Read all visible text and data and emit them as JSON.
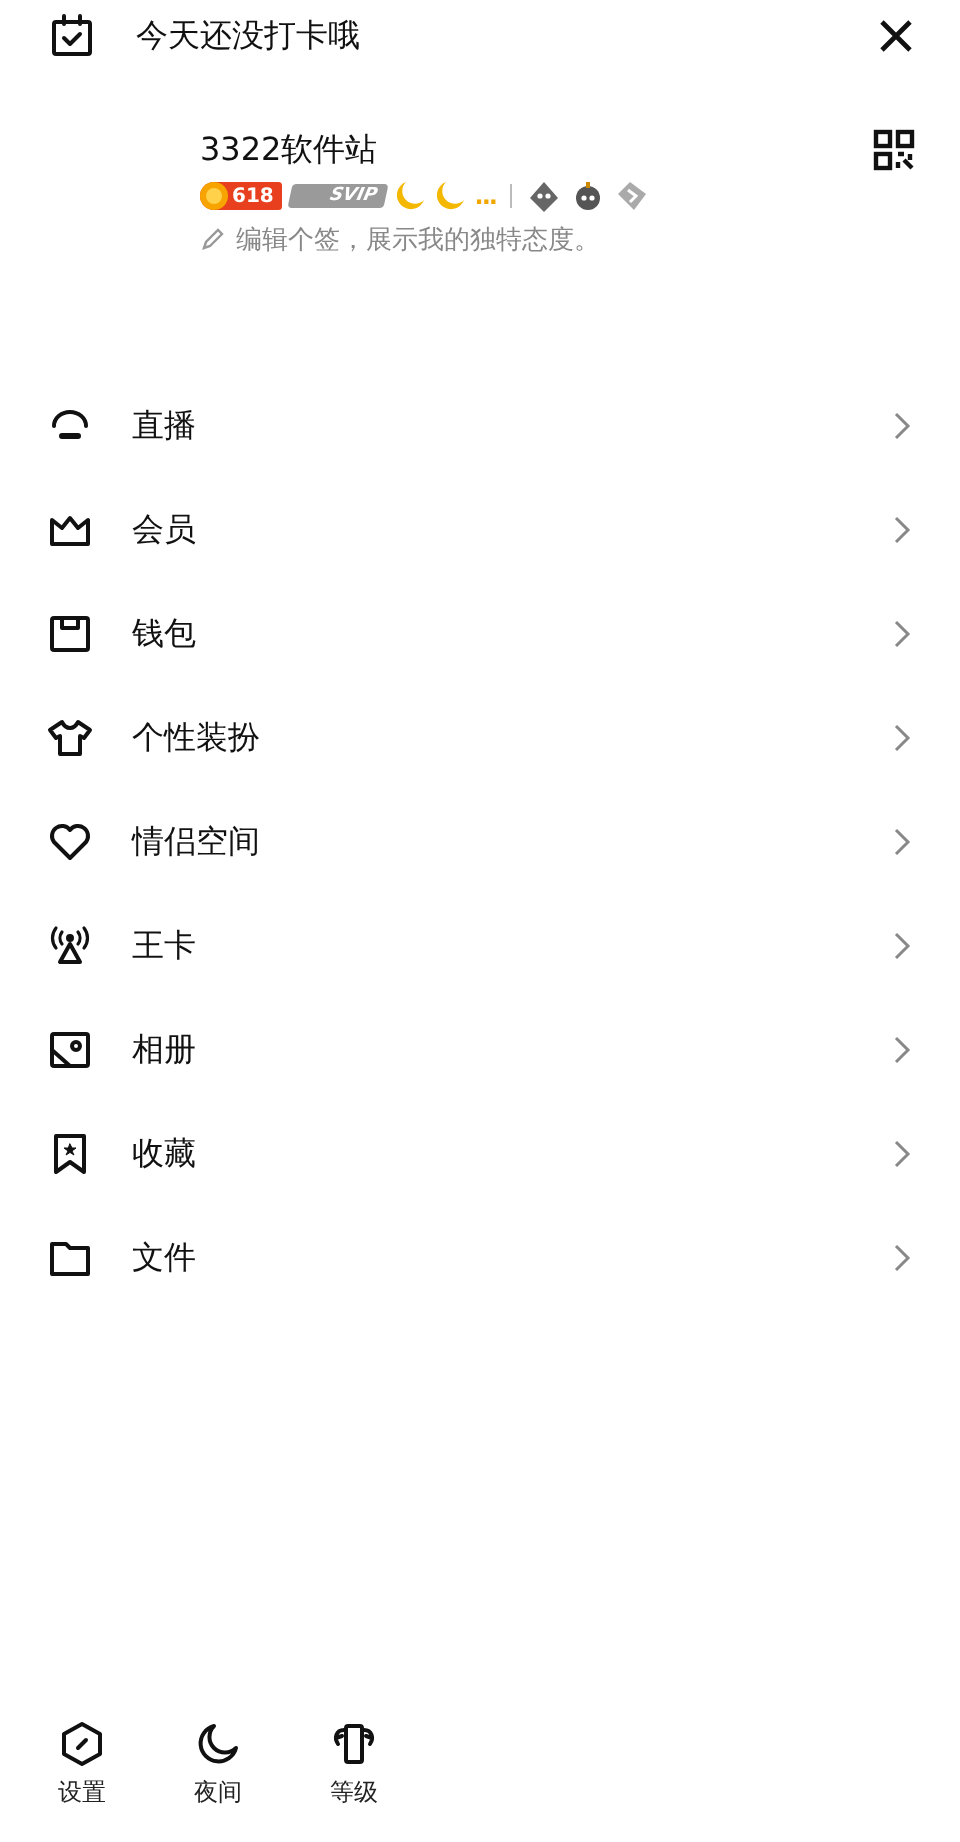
{
  "checkin": {
    "text": "今天还没打卡哦"
  },
  "profile": {
    "name": "3322软件站",
    "badges": [
      {
        "kind": "level",
        "text": "618"
      },
      {
        "kind": "vip",
        "text": "SVIP"
      },
      {
        "kind": "moon"
      },
      {
        "kind": "moon"
      },
      {
        "kind": "more",
        "text": "..."
      },
      {
        "kind": "divider"
      },
      {
        "kind": "pet"
      },
      {
        "kind": "bomb"
      },
      {
        "kind": "flag"
      }
    ],
    "signature": "编辑个签，展示我的独特态度。"
  },
  "menu": [
    {
      "kind": "live",
      "label": "直播"
    },
    {
      "kind": "crown",
      "label": "会员"
    },
    {
      "kind": "wallet",
      "label": "钱包"
    },
    {
      "kind": "shirt",
      "label": "个性装扮"
    },
    {
      "kind": "heart",
      "label": "情侣空间"
    },
    {
      "kind": "antenna",
      "label": "王卡"
    },
    {
      "kind": "photo",
      "label": "相册"
    },
    {
      "kind": "bookmark",
      "label": "收藏"
    },
    {
      "kind": "folder",
      "label": "文件"
    }
  ],
  "bottom": [
    {
      "kind": "settings",
      "label": "设置"
    },
    {
      "kind": "moon",
      "label": "夜间"
    },
    {
      "kind": "level",
      "label": "等级"
    }
  ]
}
